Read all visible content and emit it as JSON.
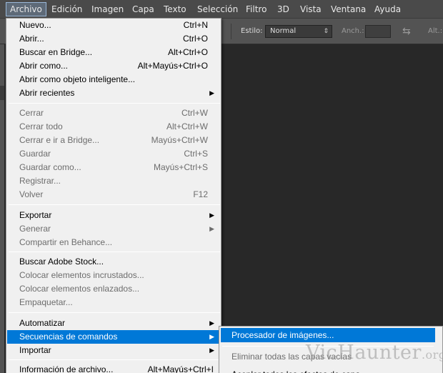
{
  "menubar": {
    "items": [
      "Archivo",
      "Edición",
      "Imagen",
      "Capa",
      "Texto",
      "Selección",
      "Filtro",
      "3D",
      "Vista",
      "Ventana",
      "Ayuda"
    ]
  },
  "options_bar": {
    "estilo_label": "Estilo:",
    "estilo_value": "Normal",
    "anch_label": "Anch.:",
    "alt_label": "Alt.:"
  },
  "file_menu": {
    "groups": [
      [
        {
          "label": "Nuevo...",
          "shortcut": "Ctrl+N",
          "enabled": true
        },
        {
          "label": "Abrir...",
          "shortcut": "Ctrl+O",
          "enabled": true
        },
        {
          "label": "Buscar en Bridge...",
          "shortcut": "Alt+Ctrl+O",
          "enabled": true
        },
        {
          "label": "Abrir como...",
          "shortcut": "Alt+Mayús+Ctrl+O",
          "enabled": true
        },
        {
          "label": "Abrir como objeto inteligente...",
          "shortcut": "",
          "enabled": true
        },
        {
          "label": "Abrir recientes",
          "shortcut": "",
          "enabled": true,
          "submenu": true
        }
      ],
      [
        {
          "label": "Cerrar",
          "shortcut": "Ctrl+W",
          "enabled": false
        },
        {
          "label": "Cerrar todo",
          "shortcut": "Alt+Ctrl+W",
          "enabled": false
        },
        {
          "label": "Cerrar e ir a Bridge...",
          "shortcut": "Mayús+Ctrl+W",
          "enabled": false
        },
        {
          "label": "Guardar",
          "shortcut": "Ctrl+S",
          "enabled": false
        },
        {
          "label": "Guardar como...",
          "shortcut": "Mayús+Ctrl+S",
          "enabled": false
        },
        {
          "label": "Registrar...",
          "shortcut": "",
          "enabled": false
        },
        {
          "label": "Volver",
          "shortcut": "F12",
          "enabled": false
        }
      ],
      [
        {
          "label": "Exportar",
          "shortcut": "",
          "enabled": true,
          "submenu": true
        },
        {
          "label": "Generar",
          "shortcut": "",
          "enabled": false,
          "submenu": true
        },
        {
          "label": "Compartir en Behance...",
          "shortcut": "",
          "enabled": false
        }
      ],
      [
        {
          "label": "Buscar Adobe Stock...",
          "shortcut": "",
          "enabled": true
        },
        {
          "label": "Colocar elementos incrustados...",
          "shortcut": "",
          "enabled": false
        },
        {
          "label": "Colocar elementos enlazados...",
          "shortcut": "",
          "enabled": false
        },
        {
          "label": "Empaquetar...",
          "shortcut": "",
          "enabled": false
        }
      ],
      [
        {
          "label": "Automatizar",
          "shortcut": "",
          "enabled": true,
          "submenu": true
        },
        {
          "label": "Secuencias de comandos",
          "shortcut": "",
          "enabled": true,
          "submenu": true,
          "highlighted": true
        },
        {
          "label": "Importar",
          "shortcut": "",
          "enabled": true,
          "submenu": true
        }
      ],
      [
        {
          "label": "Información de archivo...",
          "shortcut": "Alt+Mayús+Ctrl+I",
          "enabled": true
        }
      ]
    ]
  },
  "scripts_submenu": {
    "items": [
      {
        "label": "Procesador de imágenes...",
        "enabled": true,
        "highlighted": true
      },
      {
        "label": "Eliminar todas las capas vacías",
        "enabled": false
      },
      {
        "label": "Acoplar todos los efectos de capa",
        "enabled": true
      }
    ]
  },
  "watermark": {
    "text": "VicHaunter",
    "tld": ".org"
  },
  "colors": {
    "menu_highlight": "#0078d7",
    "menu_background": "#f0f0f0",
    "workspace": "#282828"
  }
}
